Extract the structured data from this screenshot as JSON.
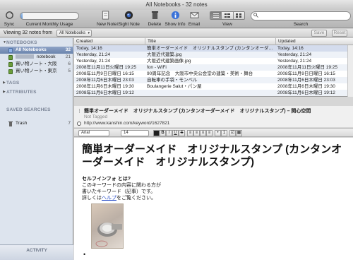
{
  "window": {
    "title": "All Notebooks - 32 notes"
  },
  "toolbar": {
    "sync_label": "Sync",
    "usage_label": "Current Monthly Usage",
    "usage_fraction": 0.04,
    "new_note_label": "New Note",
    "isight_label": "iSight Note",
    "delete_label": "Delete",
    "show_info_label": "Show Info",
    "email_label": "Email",
    "view_label": "View",
    "search_label": "Search",
    "search_placeholder": ""
  },
  "filter": {
    "viewing_text": "Viewing 32 notes from",
    "scope_value": "All Notebooks",
    "save_label": "Save",
    "reset_label": "Reset"
  },
  "sidebar": {
    "notebooks_header": "NOTEBOOKS",
    "notebooks": [
      {
        "name": "All Notebooks",
        "count": "32"
      },
      {
        "name": "notebook",
        "count": "21"
      },
      {
        "name": "買い物ノート・大阪",
        "count": "6"
      },
      {
        "name": "買い物ノート・東京",
        "count": "5"
      }
    ],
    "tags_header": "TAGS",
    "attributes_header": "ATTRIBUTES",
    "saved_searches_header": "SAVED SEARCHES",
    "trash_label": "Trash",
    "trash_count": "7",
    "activity_label": "ACTIVITY"
  },
  "note_list": {
    "columns": {
      "created": "Created",
      "title": "Title",
      "updated": "Updated"
    },
    "rows": [
      {
        "created": "Today, 14:16",
        "title": "簡単オーダーメイド　オリジナルスタンプ (カンタンオーダ…",
        "updated": "Today, 14:16"
      },
      {
        "created": "Yesterday, 21:24",
        "title": "大阪近代建築.jpg",
        "updated": "Yesterday, 21:24"
      },
      {
        "created": "Yesterday, 21:24",
        "title": "大阪近代建築画像.jpg",
        "updated": "Yesterday, 21:24"
      },
      {
        "created": "2008年11月11日火曜日 19:25",
        "title": "fon - WiFi",
        "updated": "2008年11月11日火曜日 19:25"
      },
      {
        "created": "2008年11月9日日曜日 16:15",
        "title": "90周年記念　大阪市中央公会堂の建築・美術・舞台",
        "updated": "2008年11月9日日曜日 16:15"
      },
      {
        "created": "2008年11月6日木曜日 23:03",
        "title": "自転車の手袋・モンベル",
        "updated": "2008年11月6日木曜日 23:03"
      },
      {
        "created": "2008年11月6日木曜日 19:30",
        "title": "Boulangerie Salut・パン屋",
        "updated": "2008年11月6日木曜日 19:30"
      },
      {
        "created": "2008年11月6日木曜日 19:12",
        "title": "",
        "updated": "2008年11月6日木曜日 19:12"
      }
    ]
  },
  "note": {
    "title": "簡単オーダーメイド　オリジナルスタンプ (カンタンオーダーメイド　オリジナルスタンプ) – 関心空間",
    "tags": "Not Tagged",
    "url": "http://www.kanshin.com/keyword/1627821",
    "font_family": "Arial",
    "font_size": "14",
    "heading": "簡単オーダーメイド　オリジナルスタンプ (カンタンオーダーメイド　オリジナルスタンプ)",
    "subheading": "セルフインフォ とは?",
    "line1": "このキーワードの内容に関わる方が",
    "line2": "書いたキーワード（記事）です。",
    "line3_pre": "詳しくは",
    "line3_link": "ヘルプ",
    "line3_post": "をご覧ください。"
  }
}
